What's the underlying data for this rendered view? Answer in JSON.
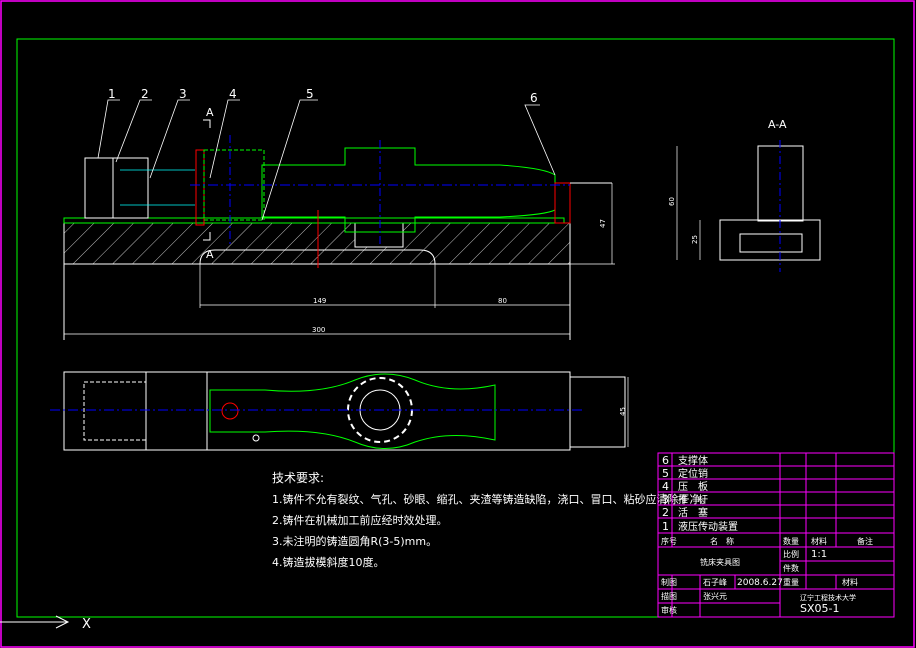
{
  "drawing": {
    "colors": {
      "background": "#000000",
      "frame": "#ff00ff",
      "border": "#00ff00",
      "centerline": "#0000ff",
      "part_outline": "#ffffff",
      "hidden": "#00ff00",
      "section": "#ff0000",
      "hatch": "#c0c0c0",
      "dim": "#ffffff"
    },
    "leaders": [
      "1",
      "2",
      "3",
      "4",
      "5",
      "6"
    ],
    "section_marker": "A",
    "section_view_title": "A-A",
    "dimensions": {
      "main_height": "47",
      "sub_height": "25",
      "section_height": "60",
      "span_149": "149",
      "span_80": "80",
      "total_300": "300",
      "top_width": "45"
    },
    "tech_requirements": {
      "title": "技术要求:",
      "items": [
        "1.铸件不允有裂纹、气孔、砂眼、缩孔、夹渣等铸造缺陷，浇口、冒口、粘砂应清除干净。",
        "2.铸件在机械加工前应经时效处理。",
        "3.未注明的铸造圆角R(3-5)mm。",
        "4.铸造拔模斜度10度。"
      ]
    },
    "parts_list": [
      {
        "no": "6",
        "name": "支撑体"
      },
      {
        "no": "5",
        "name": "定位销"
      },
      {
        "no": "4",
        "name": "压　板"
      },
      {
        "no": "3",
        "name": "推　杆"
      },
      {
        "no": "2",
        "name": "活　塞"
      },
      {
        "no": "1",
        "name": "液压传动装置"
      }
    ],
    "title_block": {
      "header_no": "序号",
      "header_name": "名　称",
      "header_qty": "数量",
      "header_material": "材料",
      "header_remark": "备注",
      "drawing_name": "铣床夹具图",
      "scale_label": "比例",
      "scale_value": "1:1",
      "piece_label": "件数",
      "drawn_label": "制图",
      "drawn_by": "石子峰",
      "date": "2008.6.27",
      "weight_label": "重量",
      "material_label": "材料",
      "design_label": "描图",
      "designer": "张兴元",
      "check_label": "审核",
      "school": "辽宁工程技术大学",
      "code": "SX05-1"
    },
    "corner_axis": "X"
  }
}
